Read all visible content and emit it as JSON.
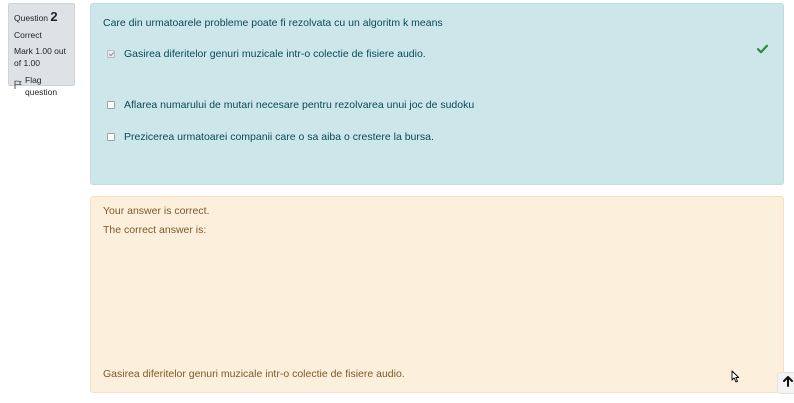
{
  "question_info": {
    "label": "Question",
    "number": "2",
    "state": "Correct",
    "grade": "Mark 1.00 out of 1.00",
    "flag_label": "Flag question"
  },
  "question": {
    "text": "Care din urmatoarele probleme poate fi rezolvata cu un algoritm k means",
    "options": [
      {
        "label": "Gasirea diferitelor genuri muzicale intr-o colectie de fisiere audio.",
        "checked": true
      },
      {
        "label": "Aflarea numarului de mutari necesare pentru rezolvarea unui joc de sudoku",
        "checked": false
      },
      {
        "label": "Prezicerea urmatoarei companii care o sa aiba o crestere la bursa.",
        "checked": false
      }
    ],
    "correct_icon": "check-icon"
  },
  "feedback": {
    "specific": "Your answer is correct.",
    "right_answer_label": "The correct answer is:",
    "right_answer": "Gasirea diferitelor genuri muzicale intr-o colectie de fisiere audio."
  },
  "colors": {
    "formulation_bg": "#cde6ea",
    "feedback_bg": "#fcefdc",
    "correct_green": "#2e8b3a"
  }
}
